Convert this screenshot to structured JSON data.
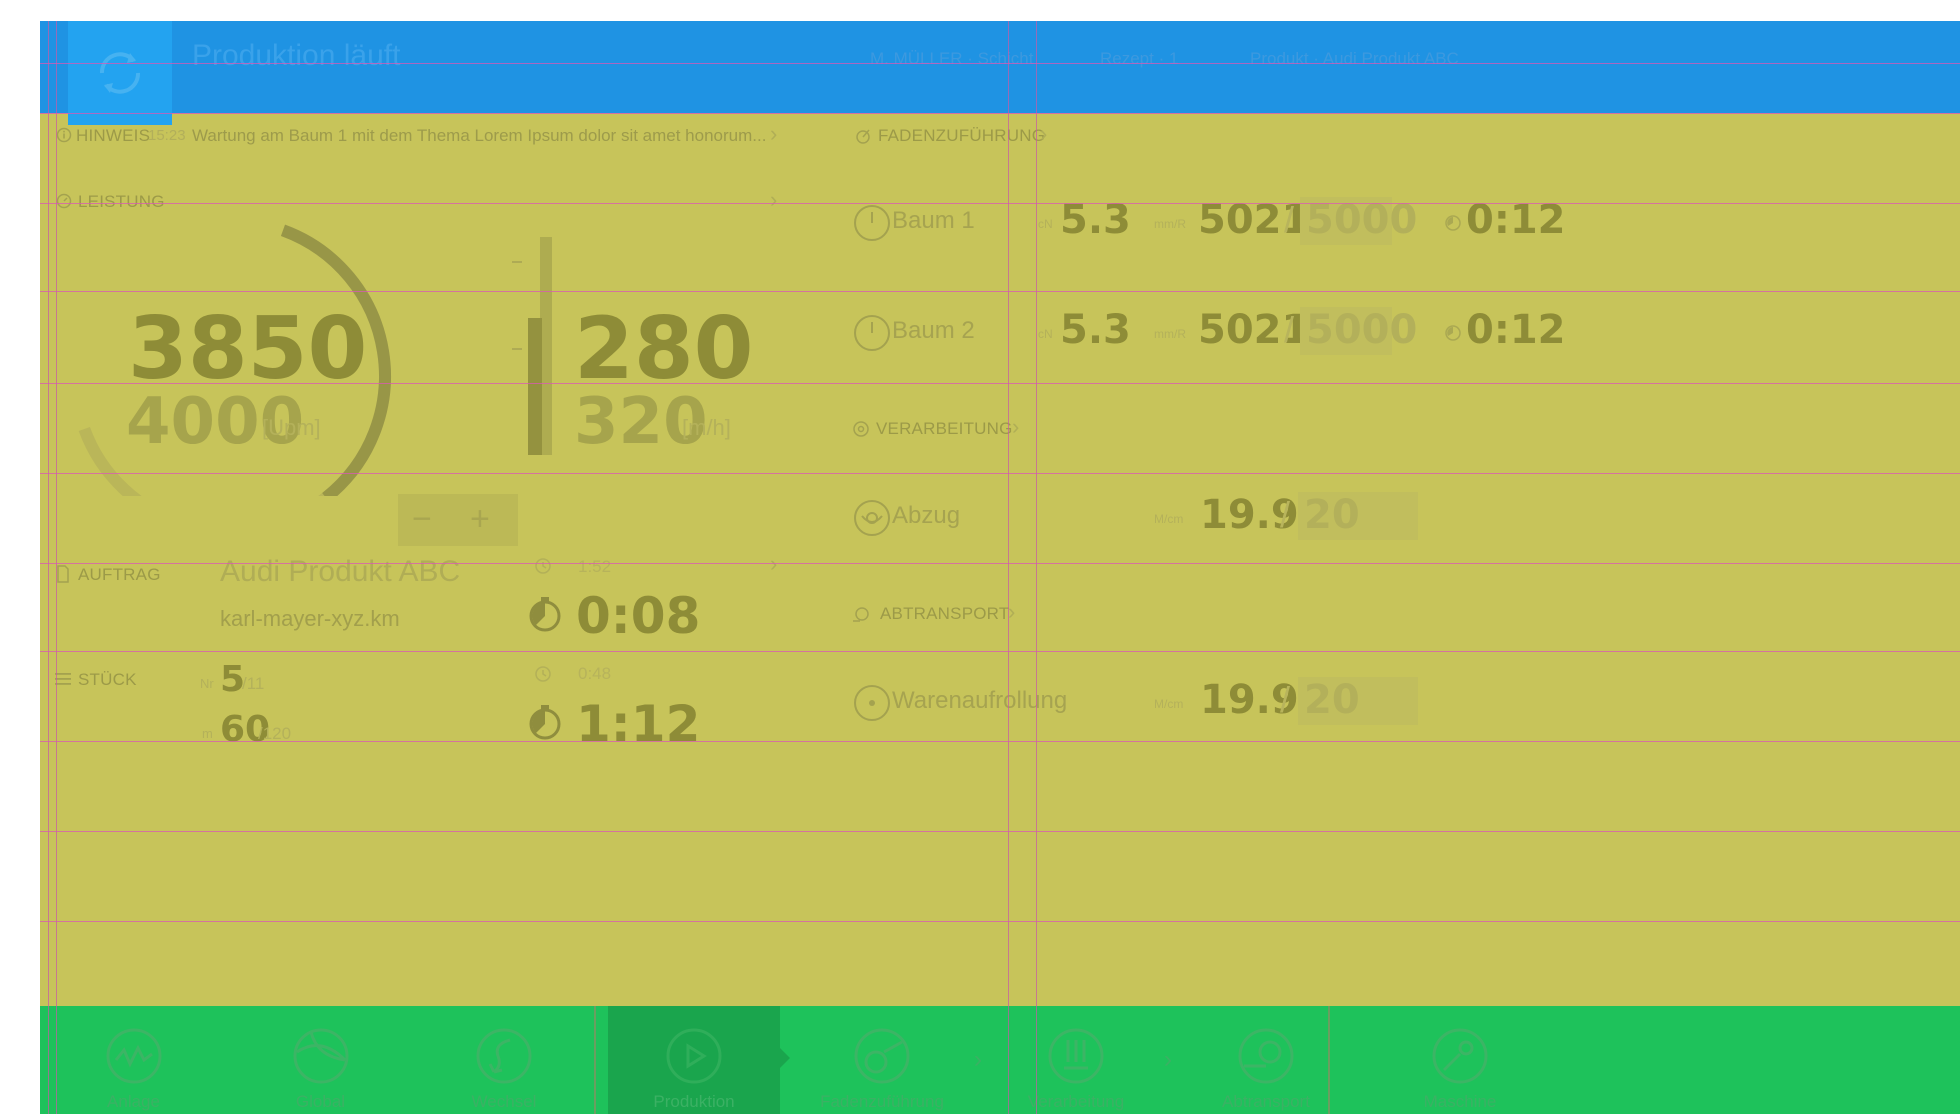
{
  "header": {
    "title": "Produktion läuft",
    "stats": [
      "M. MÜLLER · Schicht",
      "Rezept · 1",
      "Produkt · Audi Produkt ABC"
    ]
  },
  "left": {
    "hinweis": {
      "label": "HINWEIS",
      "time": "15:23",
      "text": "Wartung am  Baum 1 mit dem Thema Lorem Ipsum dolor sit amet honorum..."
    },
    "leistung": {
      "label": "LEISTUNG",
      "rpm_value": "3850",
      "rpm_target": "4000",
      "rpm_unit": "[Upm]",
      "speed_value": "280",
      "speed_target": "320",
      "speed_unit": "[m/h]",
      "rpm_fraction": 0.9625,
      "speed_fraction": 0.875,
      "minus": "−",
      "plus": "+"
    },
    "auftrag": {
      "label": "AUFTRAG",
      "product": "Audi Produkt ABC",
      "file": "karl-mayer-xyz.km",
      "clock_small": "1:52",
      "timer": "0:08"
    },
    "stueck": {
      "label": "STÜCK",
      "nr_prefix": "Nr",
      "nr_value": "5",
      "nr_total": "/11",
      "m_prefix": "m",
      "m_value": "60",
      "m_total": "/120",
      "clock_small": "0:48",
      "timer": "1:12"
    }
  },
  "right": {
    "fadenzufuehrung": {
      "label": "FADENZUFÜHRUNG",
      "rows": [
        {
          "name": "Baum 1",
          "unit1": "cN",
          "val1": "5.3",
          "unit2": "mm/R",
          "val2": "5021",
          "sep": "/",
          "target": "5000",
          "time": "0:12"
        },
        {
          "name": "Baum 2",
          "unit1": "cN",
          "val1": "5.3",
          "unit2": "mm/R",
          "val2": "5021",
          "sep": "/",
          "target": "5000",
          "time": "0:12"
        }
      ]
    },
    "verarbeitung": {
      "label": "VERARBEITUNG",
      "rows": [
        {
          "name": "Abzug",
          "unit": "M/cm",
          "val": "19.9",
          "sep": "/",
          "target": "20"
        }
      ]
    },
    "abtransport": {
      "label": "ABTRANSPORT",
      "rows": [
        {
          "name": "Warenaufrollung",
          "unit": "M/cm",
          "val": "19.9",
          "sep": "/",
          "target": "20"
        }
      ]
    }
  },
  "nav": [
    {
      "label": "Anlage",
      "icon": "anlage-icon"
    },
    {
      "label": "Global",
      "icon": "global-icon"
    },
    {
      "label": "Wechsel",
      "icon": "wechsel-icon"
    },
    {
      "label": "Produktion",
      "icon": "produktion-icon"
    },
    {
      "label": "Fadenzuführung",
      "icon": "fadenzufuehrung-icon"
    },
    {
      "label": "Verarbeitung",
      "icon": "verarbeitung-icon"
    },
    {
      "label": "Abtransport",
      "icon": "abtransport-icon"
    },
    {
      "label": "Maschine",
      "icon": "maschine-icon"
    }
  ],
  "colors": {
    "header": "#1f93e3",
    "content": "#c7c45a",
    "navbar": "#1ec25b",
    "guides": "#d958b6"
  }
}
